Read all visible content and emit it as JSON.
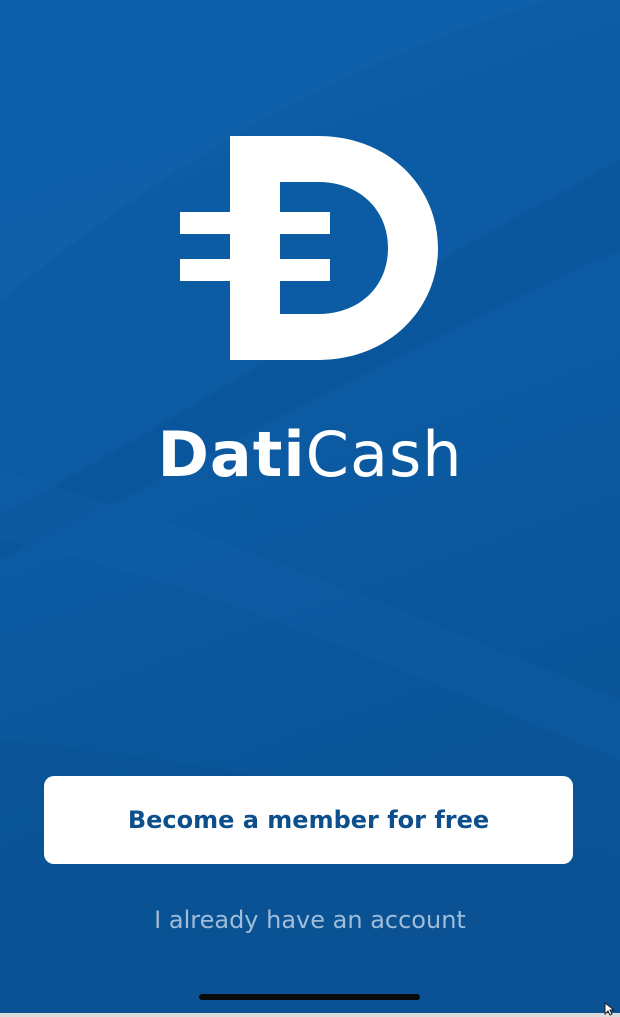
{
  "brand": {
    "name_bold": "Dati",
    "name_light": "Cash"
  },
  "actions": {
    "signup_label": "Become a member for free",
    "login_label": "I already have an account"
  },
  "icons": {
    "logo": "daticash-d-logo-icon",
    "cursor": "mouse-pointer-icon"
  },
  "colors": {
    "background": "#0b5aa2",
    "button_background": "#ffffff",
    "button_text": "#0d4f8c",
    "link_text": "#9fbddb",
    "logo": "#ffffff"
  }
}
